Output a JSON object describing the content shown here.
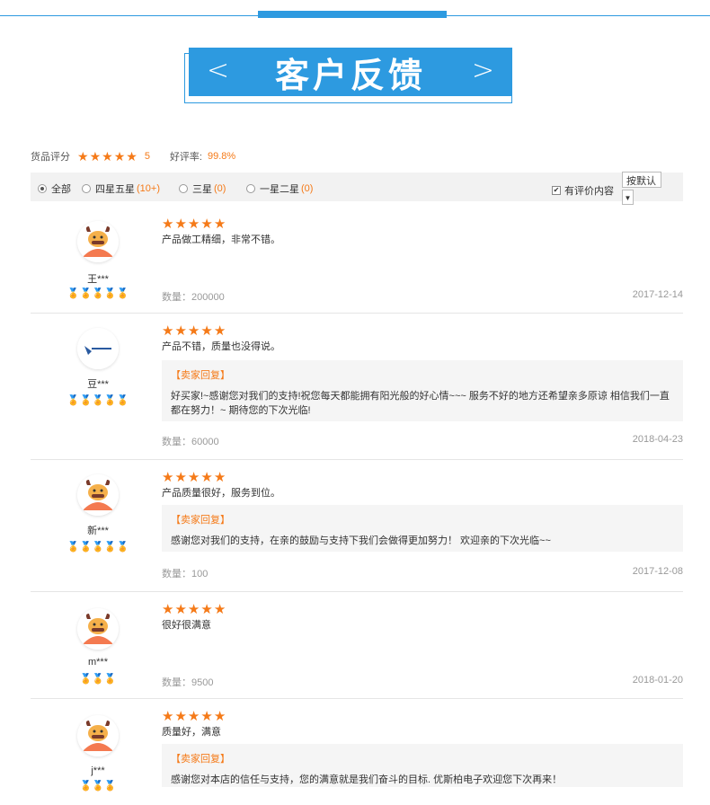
{
  "header": {
    "title": "客户反馈",
    "prev": "<",
    "next": ">"
  },
  "summary": {
    "label": "货品评分",
    "score": "5",
    "rate_label": "好评率:",
    "rate": "99.8%"
  },
  "filters": [
    {
      "label": "全部",
      "count": ""
    },
    {
      "label": "四星五星",
      "count": "(10+)"
    },
    {
      "label": "三星",
      "count": "(0)"
    },
    {
      "label": "一星二星",
      "count": "(0)"
    }
  ],
  "has_content_label": "有评价内容",
  "sort_label": "按默认",
  "reviews": [
    {
      "user": "王***",
      "text": "产品做工精细，非常不错。",
      "reply_label": "",
      "reply": "",
      "count": "数量：200000",
      "date": "2017-12-14"
    },
    {
      "user": "豆***",
      "text": "产品不错，质量也没得说。",
      "reply_label": "【卖家回复】",
      "reply": "好买家!~感谢您对我们的支持!祝您每天都能拥有阳光般的好心情~~~ 服务不好的地方还希望亲多原谅 相信我们一直都在努力！~ 期待您的下次光临!",
      "count": "数量：60000",
      "date": "2018-04-23"
    },
    {
      "user": "新***",
      "text": "产品质量很好，服务到位。",
      "reply_label": "【卖家回复】",
      "reply": "感谢您对我们的支持，在亲的鼓励与支持下我们会做得更加努力！ 欢迎亲的下次光临~~",
      "count": "数量：100",
      "date": "2017-12-08"
    },
    {
      "user": "m***",
      "text": "很好很满意",
      "reply_label": "",
      "reply": "",
      "count": "数量：9500",
      "date": "2018-01-20"
    },
    {
      "user": "j***",
      "text": "质量好，满意",
      "reply_label": "【卖家回复】",
      "reply": "感谢您对本店的信任与支持，您的满意就是我们奋斗的目标. 优斯柏电子欢迎您下次再来！",
      "count": "",
      "date": ""
    }
  ],
  "colors": {
    "accent": "#2d9ae0",
    "star": "#f57a18"
  }
}
